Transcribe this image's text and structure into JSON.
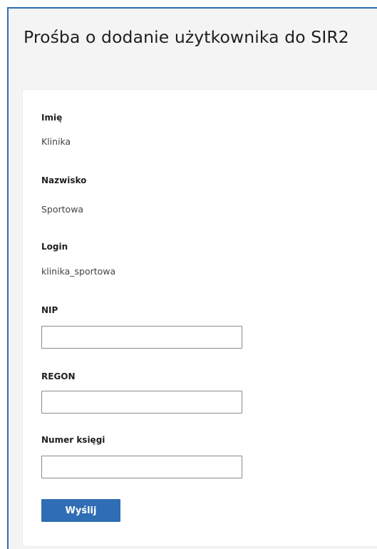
{
  "page": {
    "title": "Prośba o dodanie użytkownika do SIR2"
  },
  "form": {
    "first_name": {
      "label": "Imię",
      "value": "Klinika"
    },
    "last_name": {
      "label": "Nazwisko",
      "value": "Sportowa"
    },
    "login": {
      "label": "Login",
      "value": "klinika_sportowa"
    },
    "nip": {
      "label": "NIP",
      "value": "",
      "placeholder": ""
    },
    "regon": {
      "label": "REGON",
      "value": "",
      "placeholder": ""
    },
    "book_number": {
      "label": "Numer księgi",
      "value": "",
      "placeholder": ""
    },
    "submit_label": "Wyślij"
  },
  "colors": {
    "accent": "#2f6db4",
    "page_background": "#f4f4f4",
    "card_background": "#ffffff"
  }
}
